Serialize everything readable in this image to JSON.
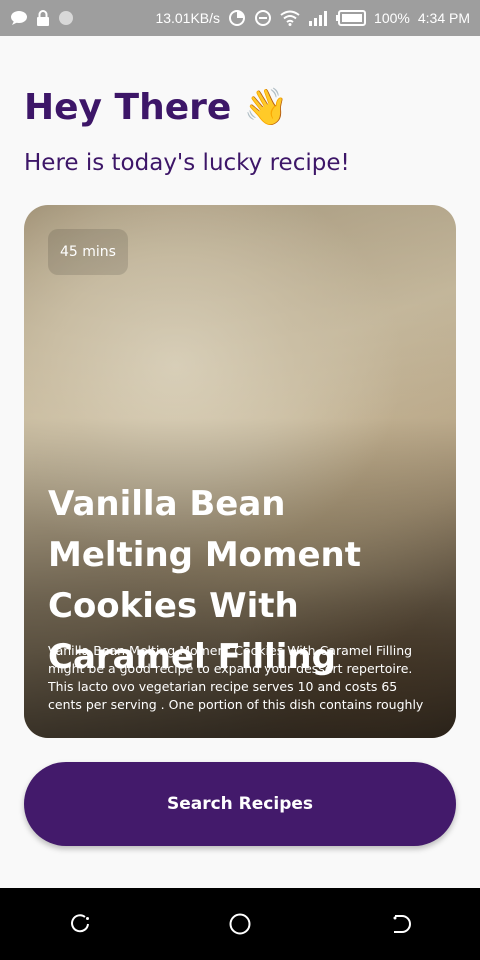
{
  "status_bar": {
    "speed": "13.01KB/s",
    "battery": "100%",
    "time": "4:34 PM",
    "icons": [
      "chat-icon",
      "lock-icon",
      "dot-icon",
      "data-usage-icon",
      "dnd-icon",
      "wifi-icon",
      "signal-icon",
      "battery-icon"
    ]
  },
  "header": {
    "greeting": "Hey There 👋",
    "subtitle": "Here is today's lucky recipe!"
  },
  "recipe": {
    "time": "45 mins",
    "title": "Vanilla Bean Melting Moment Cookies With Caramel Filling",
    "description": "Vanilla Bean Melting Moment Cookies With Caramel Filling might be a good recipe to expand your dessert repertoire. This lacto ovo vegetarian recipe serves 10 and costs  65 cents per serving . One portion of this dish contains roughly"
  },
  "actions": {
    "search_label": "Search Recipes"
  },
  "nav_bar": {
    "icons": [
      "recents-icon",
      "home-icon",
      "back-icon"
    ]
  },
  "colors": {
    "primary": "#431a6b",
    "heading": "#3d1668",
    "status_bar": "#9e9e9e",
    "background": "#f9f9f9"
  }
}
